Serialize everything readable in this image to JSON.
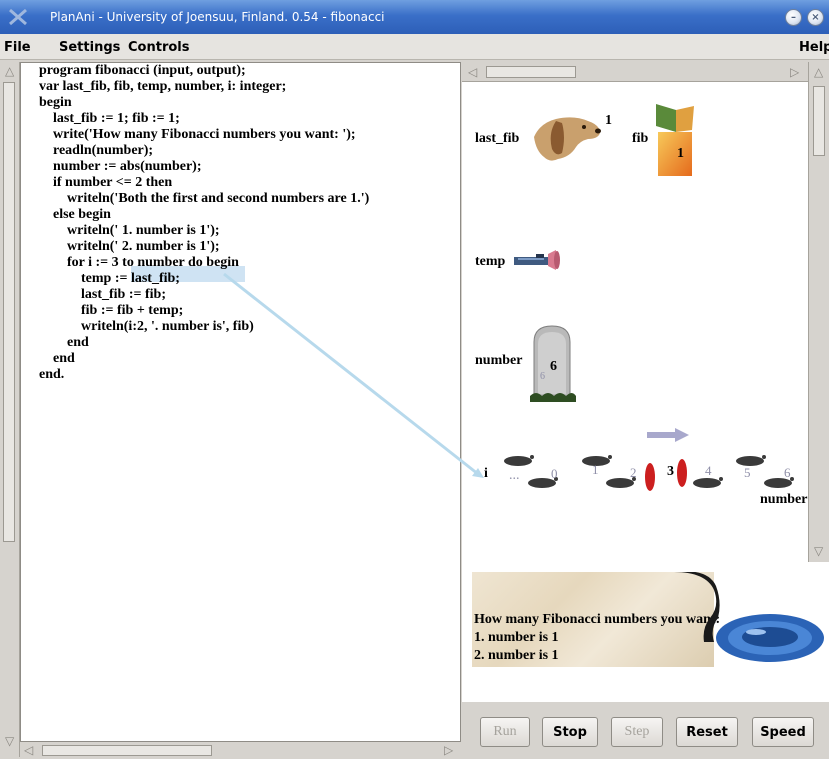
{
  "window": {
    "title": "PlanAni - University of Joensuu, Finland. 0.54 - fibonacci",
    "minimize_glyph": "–",
    "close_glyph": "×"
  },
  "menubar": {
    "file": "File",
    "settings": "Settings",
    "controls": "Controls",
    "help": "Help"
  },
  "code": {
    "lines": [
      "program fibonacci (input, output);",
      "var last_fib, fib, temp, number, i: integer;",
      "begin",
      "    last_fib := 1; fib := 1;",
      "    write('How many Fibonacci numbers you want: ');",
      "    readln(number);",
      "    number := abs(number);",
      "    if number <= 2 then",
      "        writeln('Both the first and second numbers are 1.')",
      "    else begin",
      "        writeln(' 1. number is 1');",
      "        writeln(' 2. number is 1');",
      "        for i := 3 to number do begin",
      "            temp := last_fib;",
      "            last_fib := fib;",
      "            fib := fib + temp;",
      "            writeln(i:2, '. number is', fib)",
      "        end",
      "    end",
      "end."
    ]
  },
  "variables": {
    "last_fib": {
      "label": "last_fib",
      "value": "1",
      "icon": "dog-icon"
    },
    "fib": {
      "label": "fib",
      "value": "1",
      "icon": "box-icon"
    },
    "temp": {
      "label": "temp",
      "icon": "flashlight-icon"
    },
    "number": {
      "label": "number",
      "value": "6",
      "small_value": "6",
      "icon": "tombstone-icon"
    },
    "i": {
      "label": "i",
      "ellipsis": "...",
      "steps": [
        "0",
        "1",
        "2",
        "3",
        "4",
        "5",
        "6"
      ],
      "current": "3",
      "limit_label": "number",
      "icon": "footsteps-icon"
    }
  },
  "output": {
    "lines": [
      "How many Fibonacci numbers you want:",
      "1. number is 1",
      "2. number is 1"
    ]
  },
  "buttons": {
    "run": "Run",
    "stop": "Stop",
    "step": "Step",
    "reset": "Reset",
    "speed": "Speed"
  },
  "colors": {
    "highlight": "#cfe3f3",
    "pointer": "#b7d9ec",
    "active_footprint": "#cc1f1f",
    "titlebar": "#3a6fc8"
  }
}
